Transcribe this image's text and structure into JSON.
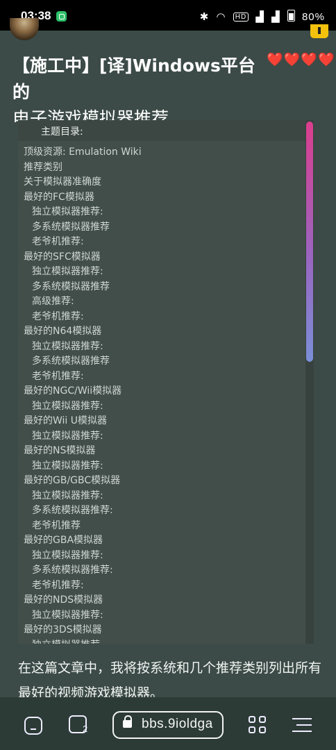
{
  "status_bar": {
    "time": "03:38",
    "battery": "80%",
    "icons": [
      "bluetooth-icon",
      "wifi-icon",
      "hd-icon",
      "signal-5g-icon",
      "signal-4g-icon",
      "battery-icon"
    ]
  },
  "article": {
    "title_line1": "【施工中】[译]Windows平台的",
    "title_line2": "电子游戏模拟器推荐",
    "reaction_icons": "❤️❤️❤️❤️"
  },
  "toc": {
    "heading": "主题目录:",
    "items": [
      {
        "label": "顶级资源:  Emulation Wiki",
        "level": 0
      },
      {
        "label": "推荐类别",
        "level": 0
      },
      {
        "label": "关于模拟器准确度",
        "level": 0
      },
      {
        "label": "最好的FC模拟器",
        "level": 0
      },
      {
        "label": "独立模拟器推荐:",
        "level": 1
      },
      {
        "label": "多系统模拟器推荐",
        "level": 1
      },
      {
        "label": "老爷机推荐:",
        "level": 1
      },
      {
        "label": "最好的SFC模拟器",
        "level": 0
      },
      {
        "label": "独立模拟器推荐:",
        "level": 1
      },
      {
        "label": "多系统模拟器推荐",
        "level": 1
      },
      {
        "label": "高级推荐:",
        "level": 1
      },
      {
        "label": "老爷机推荐:",
        "level": 1
      },
      {
        "label": "最好的N64模拟器",
        "level": 0
      },
      {
        "label": "独立模拟器推荐:",
        "level": 1
      },
      {
        "label": "多系统模拟器推荐",
        "level": 1
      },
      {
        "label": "老爷机推荐:",
        "level": 1
      },
      {
        "label": "最好的NGC/Wii模拟器",
        "level": 0
      },
      {
        "label": "独立模拟器推荐:",
        "level": 1
      },
      {
        "label": "最好的Wii U模拟器",
        "level": 0
      },
      {
        "label": "独立模拟器推荐:",
        "level": 1
      },
      {
        "label": "最好的NS模拟器",
        "level": 0
      },
      {
        "label": "独立模拟器推荐:",
        "level": 1
      },
      {
        "label": "最好的GB/GBC模拟器",
        "level": 0
      },
      {
        "label": "独立模拟器推荐:",
        "level": 1
      },
      {
        "label": "多系统模拟器推荐:",
        "level": 1
      },
      {
        "label": "老爷机推荐",
        "level": 1
      },
      {
        "label": "最好的GBA模拟器",
        "level": 0
      },
      {
        "label": "独立模拟器推荐:",
        "level": 1
      },
      {
        "label": "多系统模拟器推荐:",
        "level": 1
      },
      {
        "label": "老爷机推荐:",
        "level": 1
      },
      {
        "label": "最好的NDS模拟器",
        "level": 0
      },
      {
        "label": "独立模拟器推荐:",
        "level": 1
      },
      {
        "label": "最好的3DS模拟器",
        "level": 0
      },
      {
        "label": "独立模拟器推荐",
        "level": 1
      }
    ]
  },
  "body": {
    "paragraph": "在这篇文章中，我将按系统和几个推荐类别列出所有最好的视频游戏模拟器。"
  },
  "browser_nav": {
    "tab_count": "2",
    "url": "bbs.9ioldga"
  }
}
